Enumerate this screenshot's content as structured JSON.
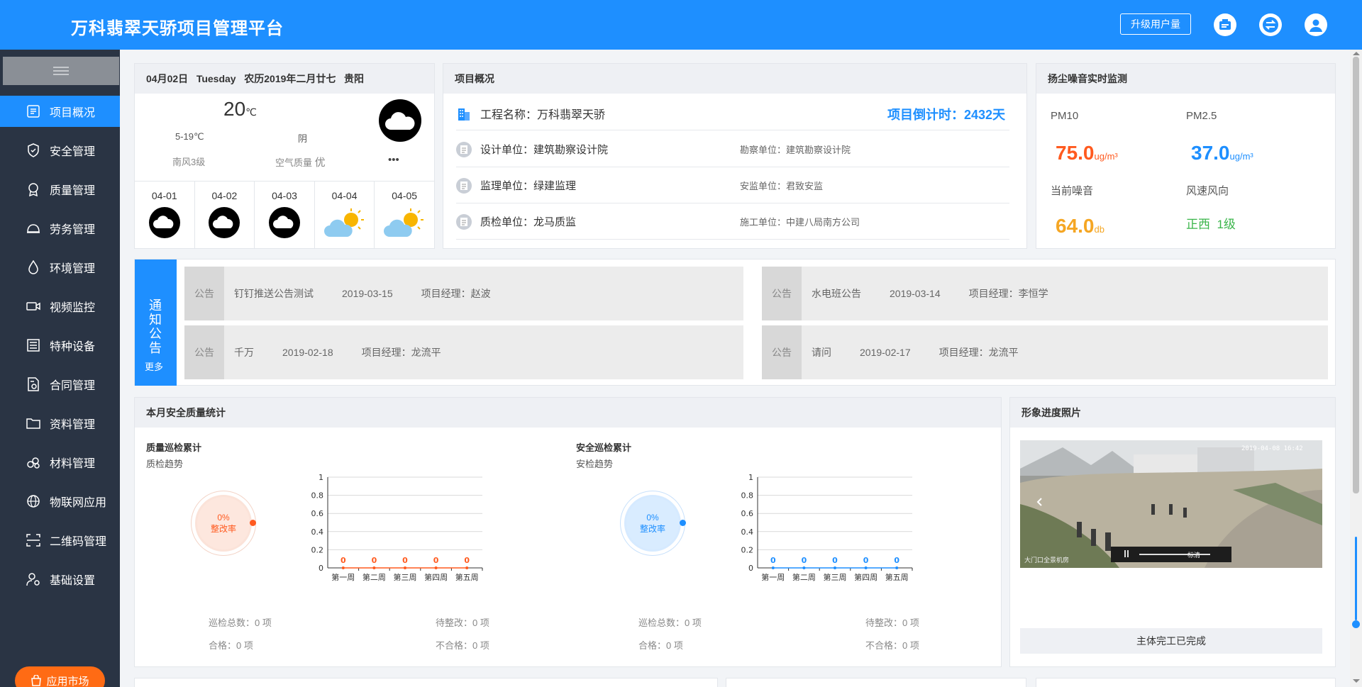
{
  "header": {
    "title": "万科翡翠天骄项目管理平台",
    "upgrade_label": "升级用户量"
  },
  "sidebar": {
    "items": [
      {
        "label": "项目概况",
        "icon": "dashboard-icon"
      },
      {
        "label": "安全管理",
        "icon": "shield-icon"
      },
      {
        "label": "质量管理",
        "icon": "quality-badge-icon"
      },
      {
        "label": "劳务管理",
        "icon": "helmet-icon"
      },
      {
        "label": "环境管理",
        "icon": "droplet-icon"
      },
      {
        "label": "视频监控",
        "icon": "video-camera-icon"
      },
      {
        "label": "特种设备",
        "icon": "equipment-list-icon"
      },
      {
        "label": "合同管理",
        "icon": "contract-icon"
      },
      {
        "label": "资料管理",
        "icon": "folder-icon"
      },
      {
        "label": "材料管理",
        "icon": "materials-icon"
      },
      {
        "label": "物联网应用",
        "icon": "globe-icon"
      },
      {
        "label": "二维码管理",
        "icon": "qr-scan-icon"
      },
      {
        "label": "基础设置",
        "icon": "user-settings-icon"
      }
    ],
    "app_market": "应用市场"
  },
  "weather": {
    "header": "04月02日   Tuesday   农历2019年二月廿七   贵阳",
    "temp": "20",
    "temp_unit": "℃",
    "range": "5-19℃",
    "condition": "阴",
    "wind": "南风3级",
    "air_label": "空气质量",
    "air_value": "优",
    "more": "•••",
    "forecast": [
      {
        "date": "04-01",
        "icon": "cloudy-icon"
      },
      {
        "date": "04-02",
        "icon": "cloudy-icon"
      },
      {
        "date": "04-03",
        "icon": "cloudy-icon"
      },
      {
        "date": "04-04",
        "icon": "partly-sunny-icon"
      },
      {
        "date": "04-05",
        "icon": "partly-sunny-icon"
      }
    ]
  },
  "project": {
    "title": "项目概况",
    "name": "工程名称：万科翡翠天骄",
    "countdown": "项目倒计时：2432天",
    "rows": [
      {
        "left": "设计单位：建筑勘察设计院",
        "right": "勘察单位：建筑勘察设计院"
      },
      {
        "left": "监理单位：绿建监理",
        "right": "安监单位：君致安监"
      },
      {
        "left": "质检单位：龙马质监",
        "right": "施工单位：中建八局南方公司"
      }
    ]
  },
  "dust": {
    "title": "扬尘噪音实时监测",
    "pm10_label": "PM10",
    "pm10_value": "75.0",
    "pm10_unit": "ug/m³",
    "pm25_label": "PM2.5",
    "pm25_value": "37.0",
    "pm25_unit": "ug/m³",
    "noise_label": "当前噪音",
    "noise_value": "64.0",
    "noise_unit": "db",
    "wind_label": "风速风向",
    "wind_value": "正西  1级",
    "colors": {
      "pm10": "#ff5a1f",
      "pm25": "#1e8fff",
      "noise": "#f5a623",
      "wind": "#3ab54a"
    }
  },
  "notice": {
    "tag": "通知公告",
    "more": "更多",
    "items": [
      {
        "type": "公告",
        "title": "钉钉推送公告测试",
        "date": "2019-03-15",
        "manager": "项目经理：赵波"
      },
      {
        "type": "公告",
        "title": "水电班公告",
        "date": "2019-03-14",
        "manager": "项目经理：李恒学"
      },
      {
        "type": "公告",
        "title": "千万",
        "date": "2019-02-18",
        "manager": "项目经理：龙流平"
      },
      {
        "type": "公告",
        "title": "请问",
        "date": "2019-02-17",
        "manager": "项目经理：龙流平"
      }
    ]
  },
  "stats": {
    "title": "本月安全质量统计",
    "quality": {
      "title": "质量巡检累计",
      "subtitle": "质检趋势",
      "rate": "0%",
      "rate_label": "整改率",
      "total": "巡检总数：0 项",
      "pending": "待整改：0 项",
      "pass": "合格：0 项",
      "fail": "不合格：0 项",
      "color": "#ff5a1f"
    },
    "safety": {
      "title": "安全巡检累计",
      "subtitle": "安检趋势",
      "rate": "0%",
      "rate_label": "整改率",
      "total": "巡检总数：0 项",
      "pending": "待整改：0 项",
      "pass": "合格：0 项",
      "fail": "不合格：0 项",
      "color": "#1e8fff"
    }
  },
  "chart_data": [
    {
      "type": "line",
      "categories": [
        "第一周",
        "第二周",
        "第三周",
        "第四周",
        "第五周"
      ],
      "series": [
        {
          "values": [
            0,
            0,
            0,
            0,
            0
          ]
        }
      ],
      "yticks": [
        "0",
        "0.2",
        "0.4",
        "0.6",
        "0.8",
        "1"
      ],
      "ylim": [
        0,
        1
      ],
      "grid": true,
      "color": "#ff5a1f"
    },
    {
      "type": "line",
      "categories": [
        "第一周",
        "第二周",
        "第三周",
        "第四周",
        "第五周"
      ],
      "series": [
        {
          "values": [
            0,
            0,
            0,
            0,
            0
          ]
        }
      ],
      "yticks": [
        "0",
        "0.2",
        "0.4",
        "0.6",
        "0.8",
        "1"
      ],
      "ylim": [
        0,
        1
      ],
      "grid": true,
      "color": "#1e8fff"
    }
  ],
  "photo": {
    "title": "形象进度照片",
    "caption": "主体完工已完成",
    "timestamp": "2019-04-08 16:42",
    "player_quality": "标清",
    "overlay_text": "大门口全景机房"
  }
}
